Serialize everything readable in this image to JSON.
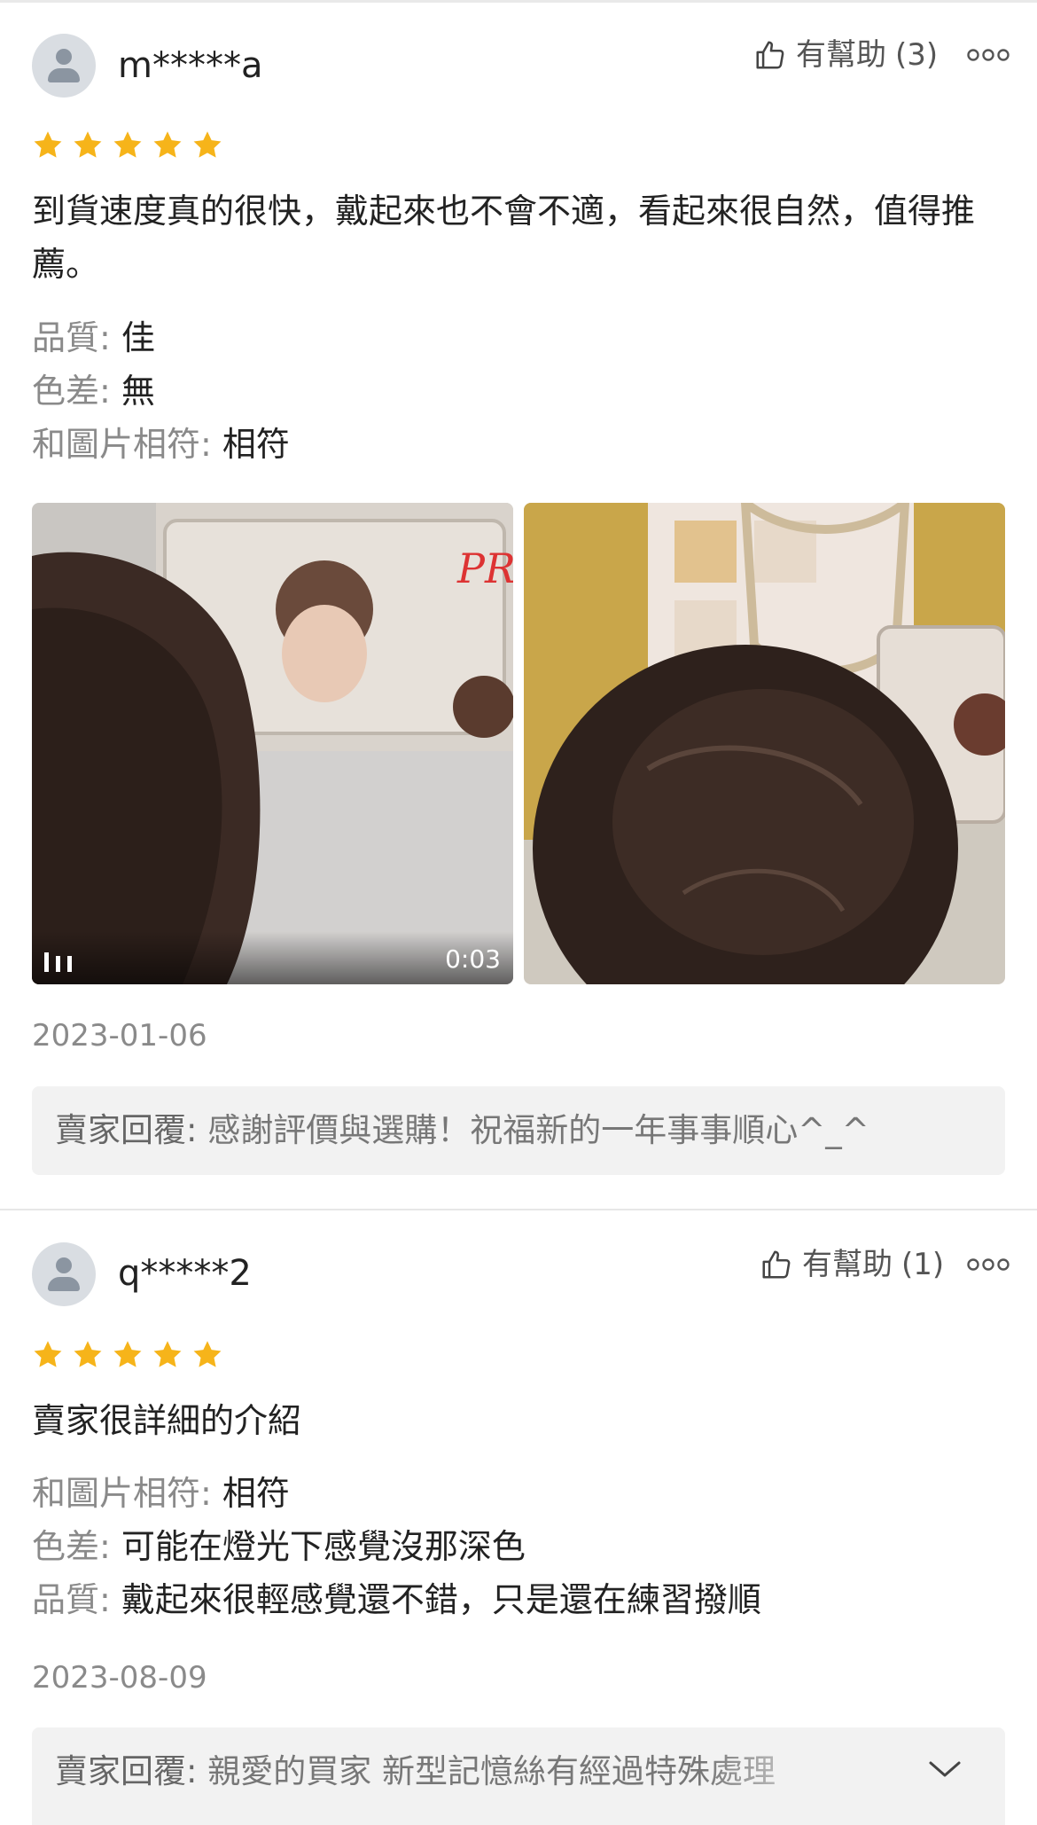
{
  "reviews": [
    {
      "username": "m*****a",
      "helpful_label": "有幫助",
      "helpful_count": "(3)",
      "rating": 5,
      "text": "到貨速度真的很快，戴起來也不會不適，看起來很自然，值得推薦。",
      "attributes": [
        {
          "label": "品質:",
          "value": "佳"
        },
        {
          "label": "色差:",
          "value": "無"
        },
        {
          "label": "和圖片相符:",
          "value": "相符"
        }
      ],
      "media": {
        "video_duration": "0:03",
        "video_caption": "PRI",
        "icons": [
          "video-bars-icon"
        ]
      },
      "date": "2023-01-06",
      "seller_reply_label": "賣家回覆:",
      "seller_reply": "感謝評價與選購！祝福新的一年事事順心^_^"
    },
    {
      "username": "q*****2",
      "helpful_label": "有幫助",
      "helpful_count": "(1)",
      "rating": 5,
      "text": "賣家很詳細的介紹",
      "attributes": [
        {
          "label": "和圖片相符:",
          "value": "相符"
        },
        {
          "label": "色差:",
          "value": "可能在燈光下感覺沒那深色"
        },
        {
          "label": "品質:",
          "value": "戴起來很輕感覺還不錯，只是還在練習撥順"
        }
      ],
      "date": "2023-08-09",
      "seller_reply_label": "賣家回覆:",
      "seller_reply": "親愛的買家 新型記憶絲有經過特殊處理"
    }
  ],
  "colors": {
    "star": "#f6b41a",
    "muted_text": "#8a8a8a",
    "reply_bg": "#f2f2f2"
  }
}
